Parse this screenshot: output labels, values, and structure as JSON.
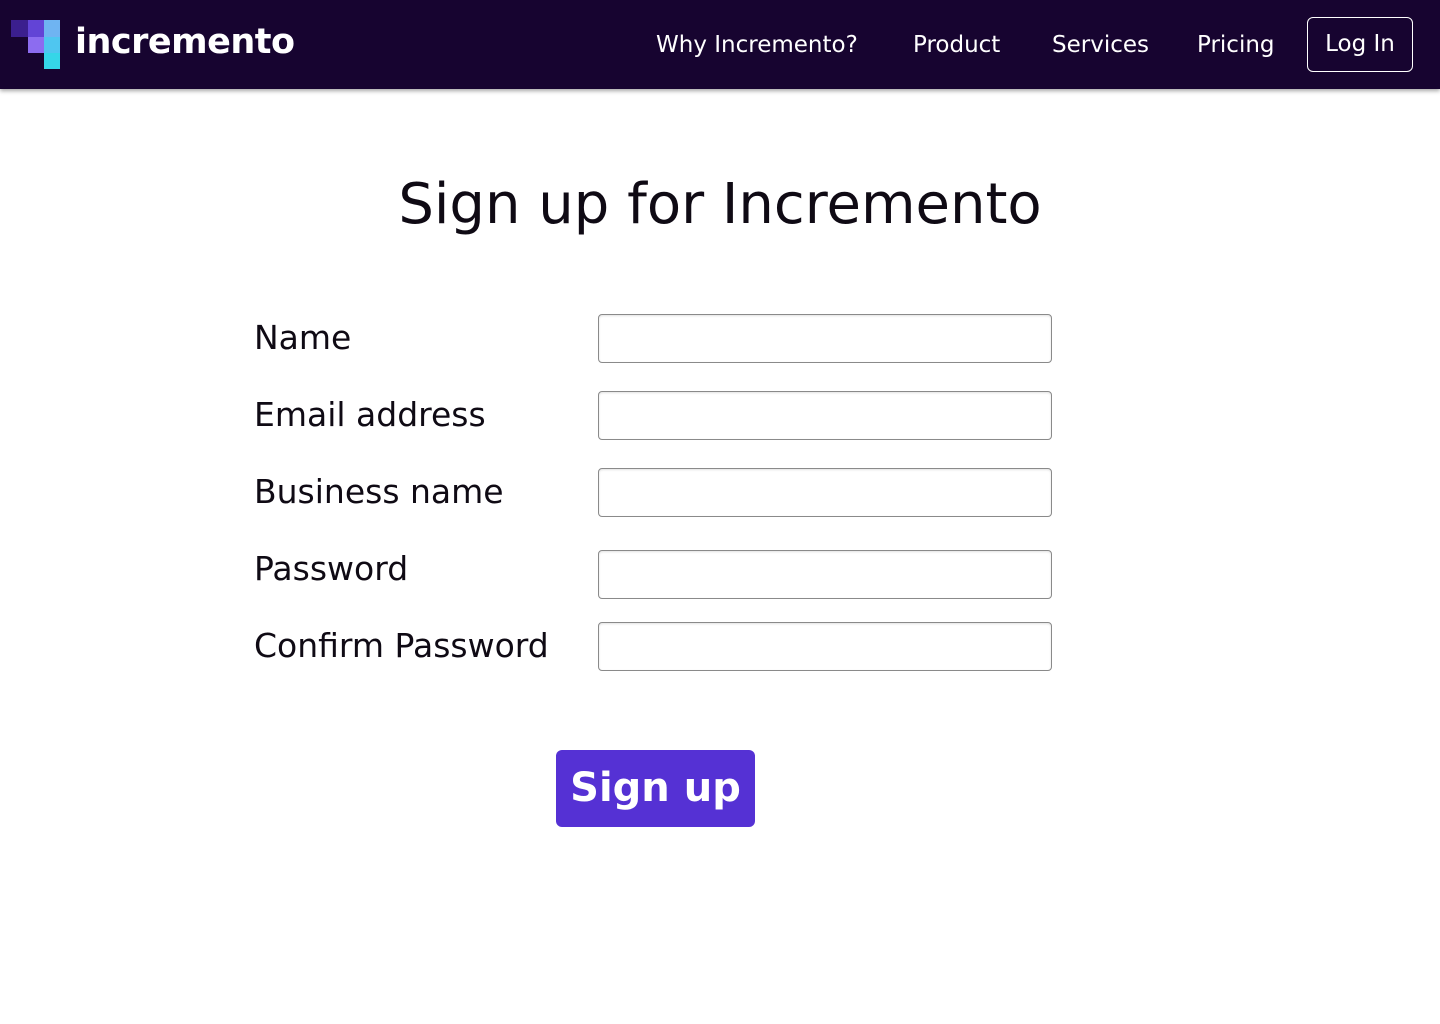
{
  "header": {
    "logo_text": "incremento",
    "nav": {
      "why": "Why Incremento?",
      "product": "Product",
      "services": "Services",
      "pricing": "Pricing"
    },
    "login_label": "Log In"
  },
  "main": {
    "title": "Sign up for Incremento",
    "fields": {
      "name": {
        "label": "Name",
        "value": ""
      },
      "email": {
        "label": "Email address",
        "value": ""
      },
      "business": {
        "label": "Business name",
        "value": ""
      },
      "password": {
        "label": "Password",
        "value": ""
      },
      "confirm": {
        "label": "Confirm Password",
        "value": ""
      }
    },
    "submit_label": "Sign up"
  },
  "colors": {
    "navbar_bg": "#170430",
    "accent": "#5531d4",
    "text": "#0f0a14"
  },
  "icons": {
    "logo": "incremento-logo-icon"
  }
}
